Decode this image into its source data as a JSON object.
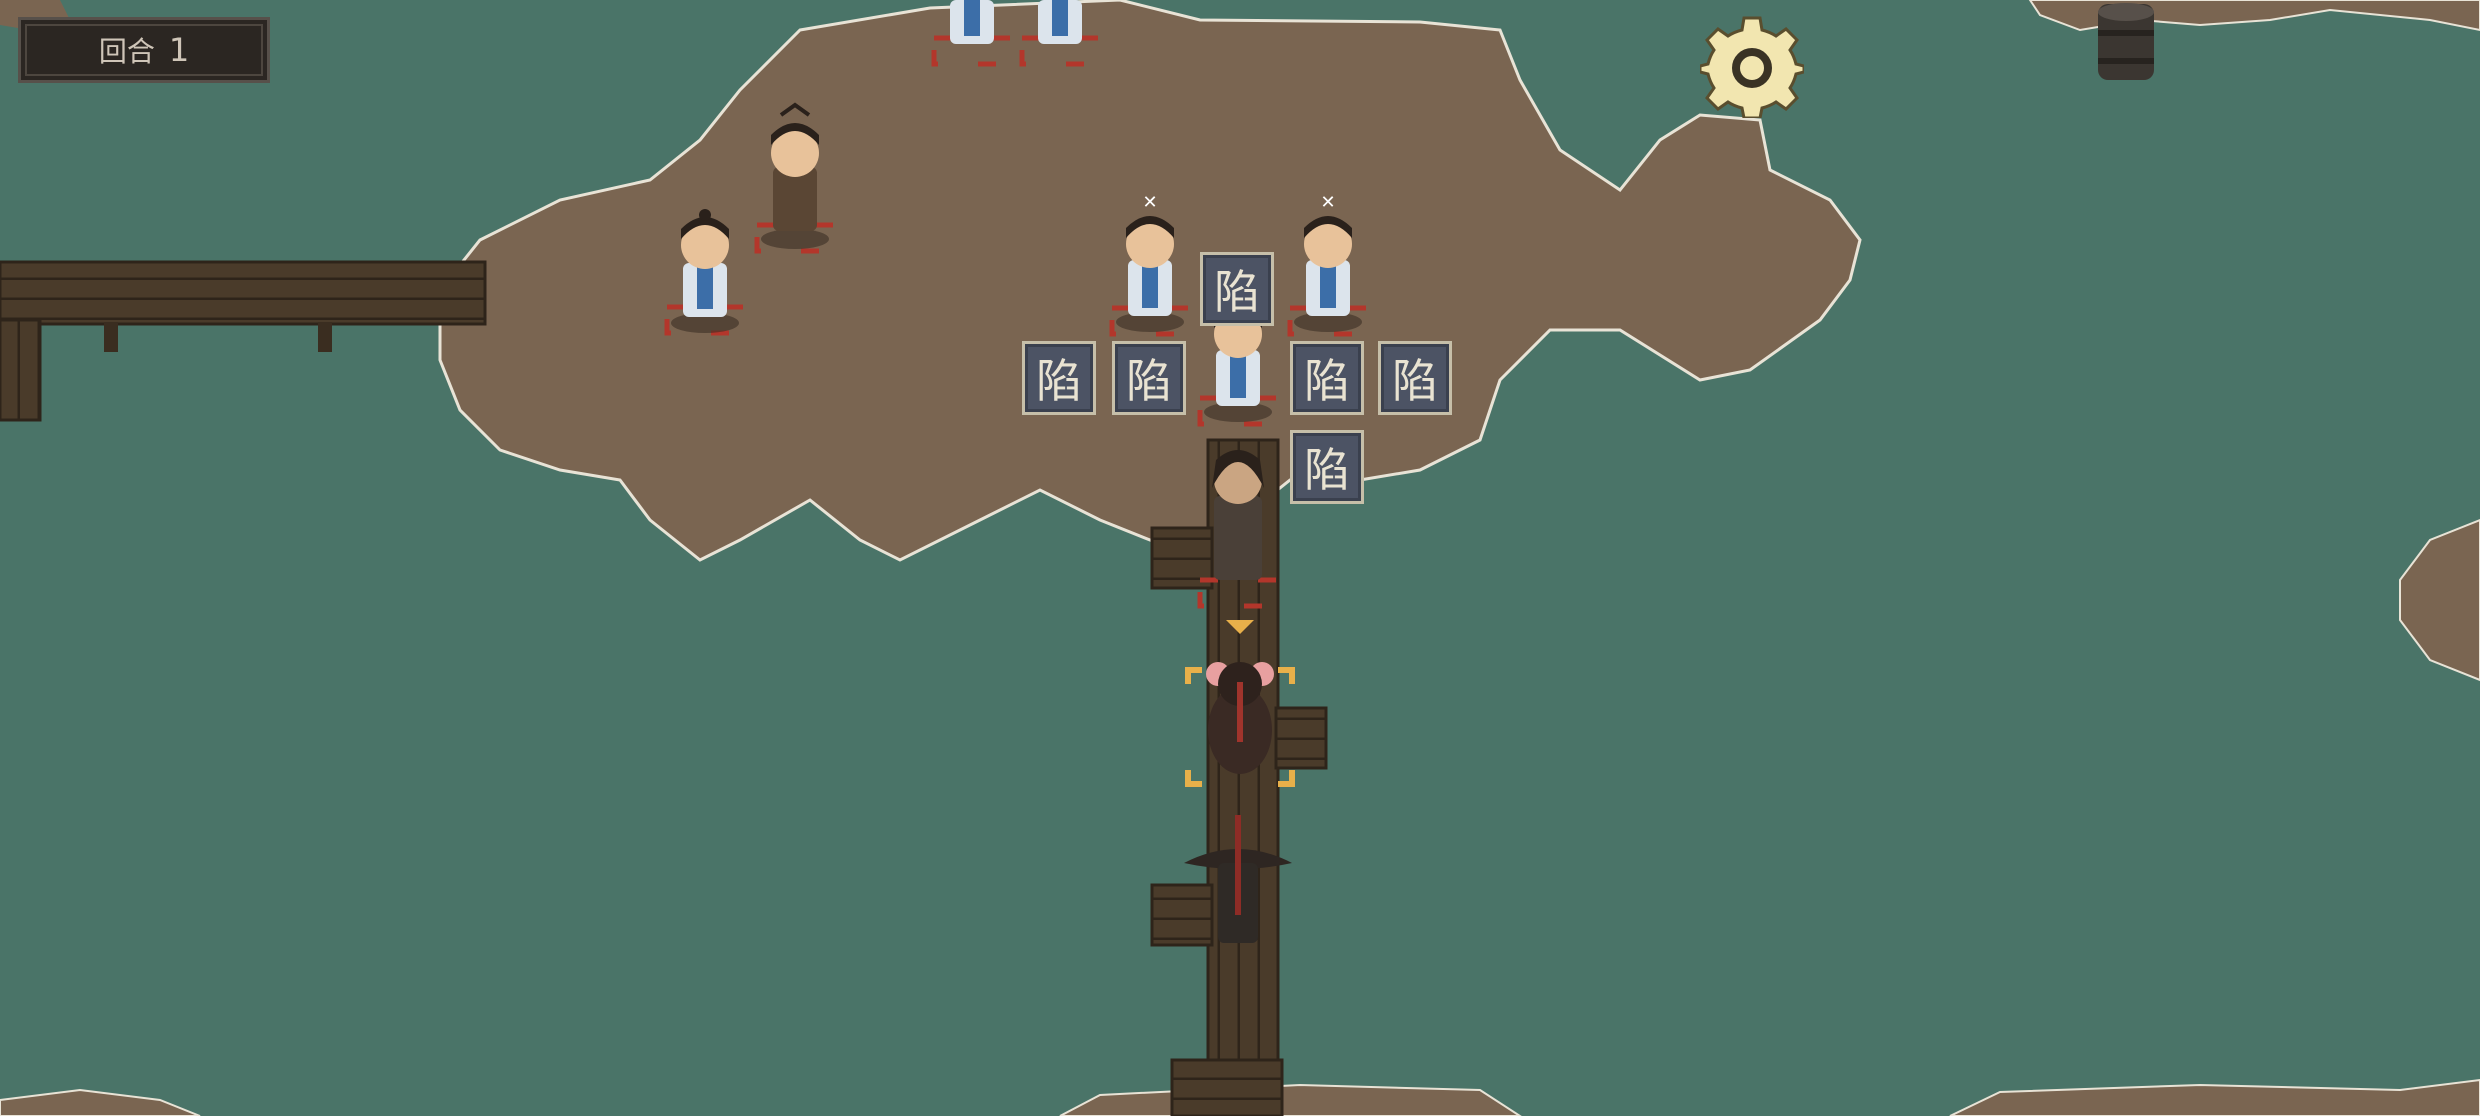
{
  "hud": {
    "turn_label": "回合",
    "turn_number": "1"
  },
  "settings_button": {
    "icon": "gear-icon"
  },
  "trap_tiles": {
    "label": "陷"
  },
  "units": {
    "enemy_allegiance_color": "#b3362b",
    "selection_color": "#e8b04a"
  },
  "colors": {
    "water": "#4a7468",
    "land": "#7a6551",
    "bridge": "#4a3b2a",
    "trap_tile": "#4c5364",
    "gear": "#f2e6b0"
  }
}
